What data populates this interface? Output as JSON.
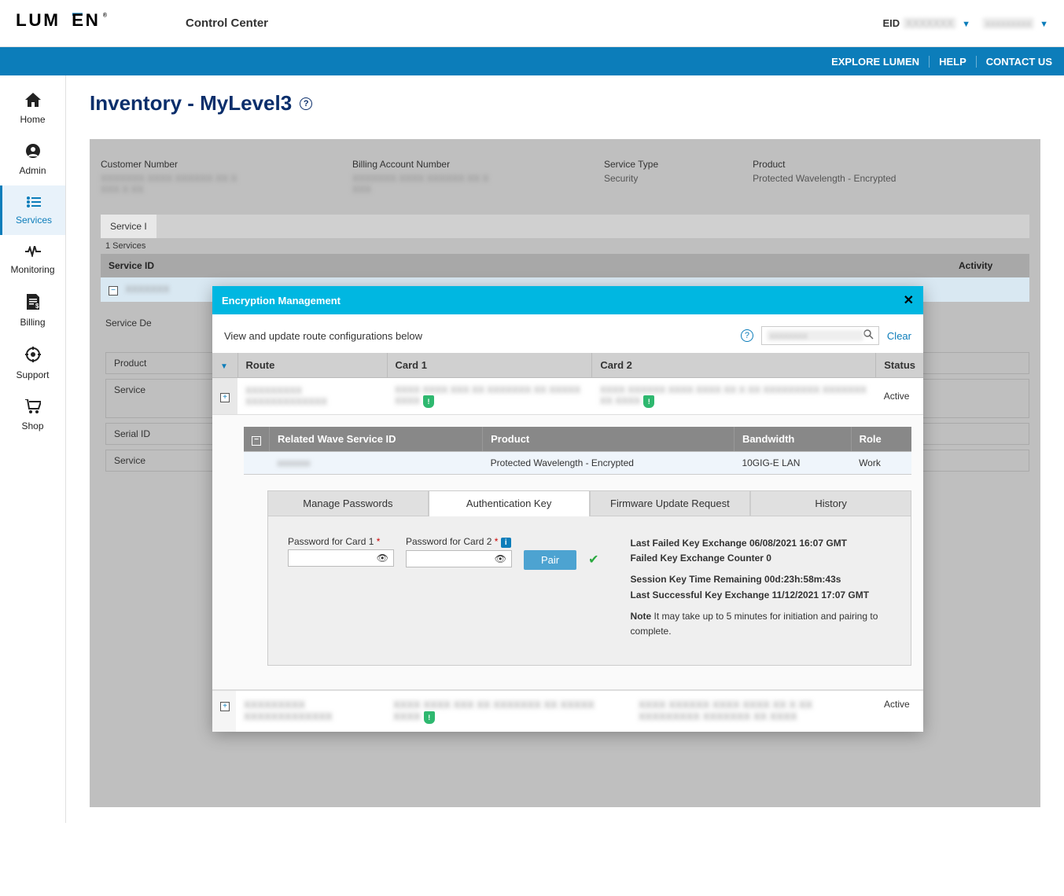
{
  "header": {
    "logo_text": "LUMEN",
    "app_title": "Control Center",
    "eid_label": "EID",
    "eid_value": "XXXXXXX",
    "user_name": "xxxxxxxxx"
  },
  "blue_bar": {
    "explore": "EXPLORE LUMEN",
    "help": "HELP",
    "contact": "CONTACT US"
  },
  "sidebar": {
    "items": [
      {
        "label": "Home",
        "icon": "home"
      },
      {
        "label": "Admin",
        "icon": "admin"
      },
      {
        "label": "Services",
        "icon": "services"
      },
      {
        "label": "Monitoring",
        "icon": "monitoring"
      },
      {
        "label": "Billing",
        "icon": "billing"
      },
      {
        "label": "Support",
        "icon": "support"
      },
      {
        "label": "Shop",
        "icon": "shop"
      }
    ]
  },
  "page": {
    "title": "Inventory - MyLevel3"
  },
  "panel_meta": {
    "customer_number_label": "Customer Number",
    "billing_account_label": "Billing Account Number",
    "service_type_label": "Service Type",
    "service_type_value": "Security",
    "product_label": "Product",
    "product_value": "Protected Wavelength - Encrypted"
  },
  "bg": {
    "service_tab": "Service I",
    "services_count": "1 Services",
    "col_service_id": "Service ID",
    "col_activity": "Activity",
    "service_details_label": "Service De",
    "product_label": "Product",
    "service_label": "Service",
    "serial_label": "Serial ID",
    "service2_label": "Service"
  },
  "modal": {
    "title": "Encryption Management",
    "subtitle": "View and update route configurations below",
    "search_placeholder": "",
    "search_value": "xxxxxxxx",
    "clear": "Clear",
    "cols": {
      "route": "Route",
      "card1": "Card 1",
      "card2": "Card 2",
      "status": "Status"
    },
    "row1": {
      "route": "XXXXXXXXX XXXXXXXXXXXXX",
      "card1": "XXXX XXXX XXX XX XXXXXXX XX XXXXX XXXX",
      "card2": "XXXX XXXXXX XXXX XXXX XX X XX XXXXXXXXX XXXXXXX XX XXXX",
      "status": "Active"
    },
    "inner_cols": {
      "related": "Related Wave Service ID",
      "product": "Product",
      "bandwidth": "Bandwidth",
      "role": "Role"
    },
    "inner_row": {
      "related": "xxxxxxx",
      "product": "Protected Wavelength - Encrypted",
      "bandwidth": "10GIG-E LAN",
      "role": "Work"
    },
    "tabs": {
      "manage_passwords": "Manage Passwords",
      "auth_key": "Authentication Key",
      "firmware": "Firmware Update Request",
      "history": "History"
    },
    "auth_pane": {
      "pw1_label": "Password for Card 1",
      "pw2_label": "Password for Card 2",
      "pair_button": "Pair",
      "last_failed_label": "Last Failed Key Exchange",
      "last_failed_value": "06/08/2021 16:07 GMT",
      "failed_counter_label": "Failed Key Exchange Counter",
      "failed_counter_value": "0",
      "session_time_label": "Session Key Time Remaining",
      "session_time_value": "00d:23h:58m:43s",
      "last_success_label": "Last Successful Key Exchange",
      "last_success_value": "11/12/2021 17:07 GMT",
      "note_label": "Note",
      "note_text": "It may take up to 5 minutes for initiation and pairing to complete."
    },
    "row2": {
      "route": "XXXXXXXXX XXXXXXXXXXXXX",
      "card1": "XXXX XXXX XXX XX XXXXXXX XX XXXXX XXXX",
      "card2": "XXXX XXXXXX XXXX XXXX XX X XX XXXXXXXXX XXXXXXX XX XXXX",
      "status": "Active"
    }
  }
}
